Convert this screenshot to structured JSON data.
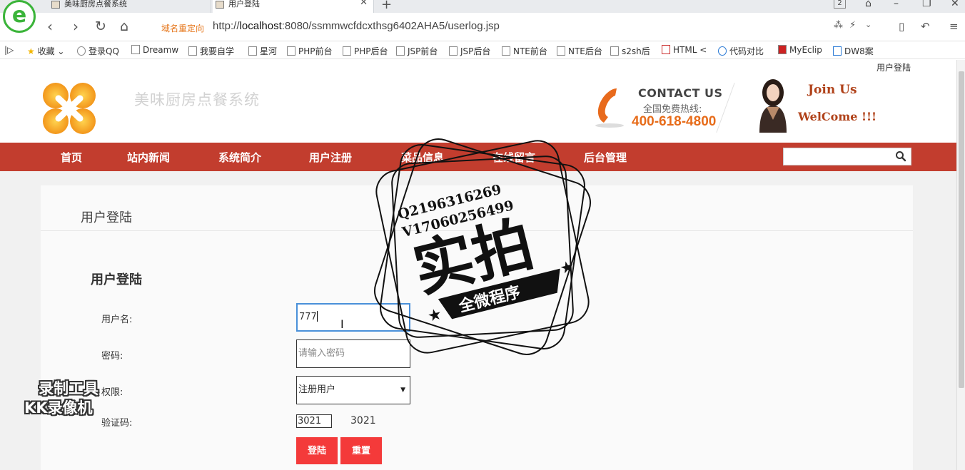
{
  "browser": {
    "tabs": [
      {
        "title": "美味厨房点餐系统"
      },
      {
        "title": "用户登陆"
      }
    ],
    "tab_count": "2",
    "redirect_label": "域名重定向",
    "url_prefix": "http://",
    "url_host": "localhost",
    "url_rest": ":8080/ssmmwcfdcxthsg6402AHA5/userlog.jsp",
    "bookmarks": [
      "收藏",
      "登录QQ",
      "Dreamw",
      "我要自学",
      "星河",
      "PHP前台",
      "PHP后台",
      "JSP前台",
      "JSP后台",
      "NTE前台",
      "NTE后台",
      "s2sh后",
      "HTML <",
      "代码对比",
      "MyEclip",
      "DW8案"
    ]
  },
  "header": {
    "top_link": "用户登陆",
    "site_title": "美味厨房点餐系统",
    "contact_title": "CONTACT US",
    "contact_sub": "全国免费热线:",
    "contact_phone": "400-618-4800",
    "join": "Join Us",
    "welcome": "WelCome !!!"
  },
  "menu": {
    "items": [
      "首页",
      "站内新闻",
      "系统简介",
      "用户注册",
      "菜品信息",
      "在线留言",
      "后台管理"
    ],
    "search_placeholder": ""
  },
  "panel": {
    "title": "用户登陆",
    "form_title": "用户登陆",
    "username_label": "用户名:",
    "username_value": "777",
    "password_label": "密码:",
    "password_placeholder": "请输入密码",
    "role_label": "权限:",
    "role_value": "注册用户",
    "captcha_label": "验证码:",
    "captcha_input": "3021",
    "captcha_text": "3021",
    "login_button": "登陆",
    "reset_button": "重置"
  },
  "overlay": {
    "stamp_line1": "Q2196316269",
    "stamp_line2": "V1706025649​9",
    "stamp_big": "实拍",
    "stamp_band": "全微程序",
    "watermark_line1": "录制工具",
    "watermark_line2": "KK录像机"
  },
  "colors": {
    "menu_bg": "#c23d2e",
    "button_bg": "#f43a3a",
    "phone_orange": "#e76c1a",
    "active_border": "#4a90d9"
  }
}
